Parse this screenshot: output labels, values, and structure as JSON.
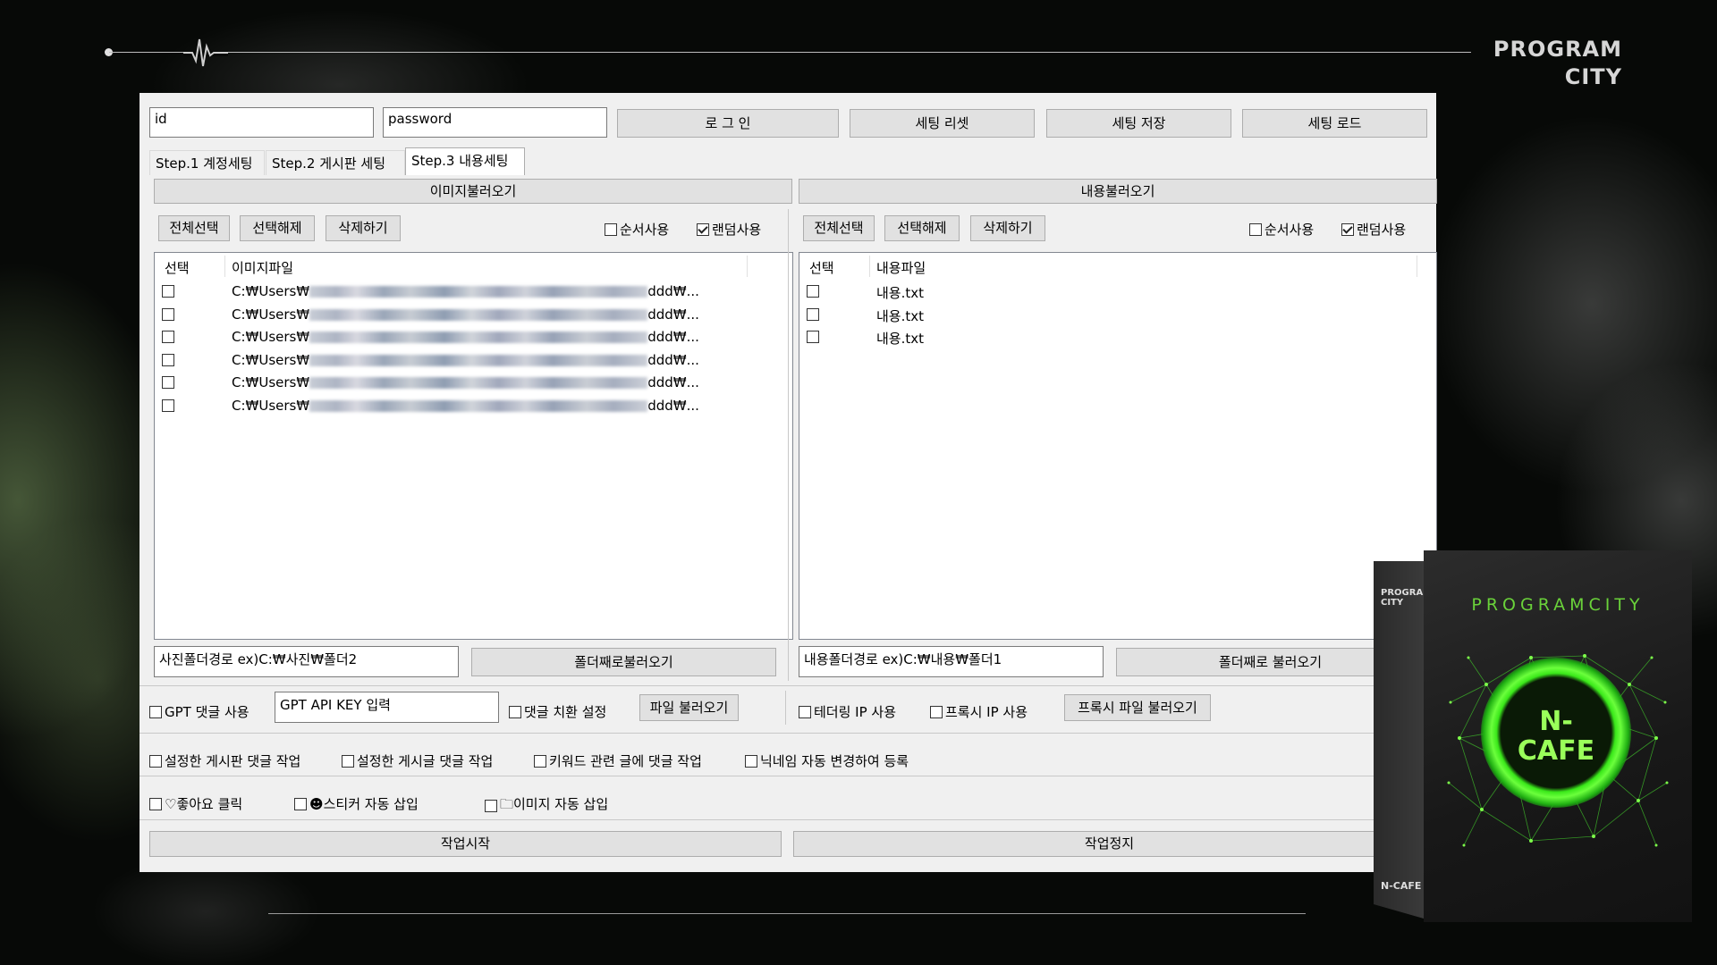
{
  "logo": {
    "line1": "PROGRAM",
    "line2": "CITY"
  },
  "login": {
    "id_value": "id",
    "password_value": "password",
    "login_button": "로 그 인",
    "reset_button": "세팅 리셋",
    "save_button": "세팅 저장",
    "load_button": "세팅 로드"
  },
  "tabs": [
    {
      "label": "Step.1 계정세팅"
    },
    {
      "label": "Step.2 게시판 세팅"
    },
    {
      "label": "Step.3 내용세팅"
    }
  ],
  "images_panel": {
    "load_button": "이미지불러오기",
    "select_all": "전체선택",
    "deselect": "선택해제",
    "delete": "삭제하기",
    "sequential": "순서사용",
    "random": "랜덤사용",
    "col_select": "선택",
    "col_file": "이미지파일",
    "row_prefix": "C:₩Users₩",
    "row_suffix": "ddd₩...",
    "row_count": 6,
    "folder_input": "사진폴더경로 ex)C:₩사진₩폴더2",
    "folder_button": "폴더째로불러오기"
  },
  "content_panel": {
    "load_button": "내용불러오기",
    "select_all": "전체선택",
    "deselect": "선택해제",
    "delete": "삭제하기",
    "sequential": "순서사용",
    "random": "랜덤사용",
    "col_select": "선택",
    "col_file": "내용파일",
    "rows": [
      "내용.txt",
      "내용.txt",
      "내용.txt"
    ],
    "folder_input": "내용폴더경로 ex)C:₩내용₩폴더1",
    "folder_button": "폴더째로 불러오기"
  },
  "options": {
    "gpt_comment": "GPT 댓글 사용",
    "gpt_key": "GPT API KEY 입력",
    "comment_replace": "댓글 치환 설정",
    "file_load": "파일 불러오기",
    "tethering": "테더링 IP 사용",
    "proxy": "프록시 IP 사용",
    "proxy_file": "프록시 파일 불러오기",
    "board_comment": "설정한 게시판 댓글 작업",
    "post_comment": "설정한 게시글 댓글 작업",
    "keyword_comment": "키워드 관련 글에 댓글 작업",
    "nickname": "닉네임 자동 변경하여 등록",
    "like": "♡좋아요 클릭",
    "sticker": "☻스티커 자동 삽입",
    "image_insert": "🗀이미지 자동 삽입"
  },
  "actions": {
    "start": "작업시작",
    "stop": "작업정지"
  },
  "product": {
    "side_top": "PROGRAM CITY",
    "brand": "PROGRAMCITY",
    "title_line1": "N-",
    "title_line2": "CAFE",
    "side_bottom": "N-CAFE"
  },
  "colors": {
    "accent_green": "#3ae81a",
    "window_bg": "#f0f0f0"
  }
}
